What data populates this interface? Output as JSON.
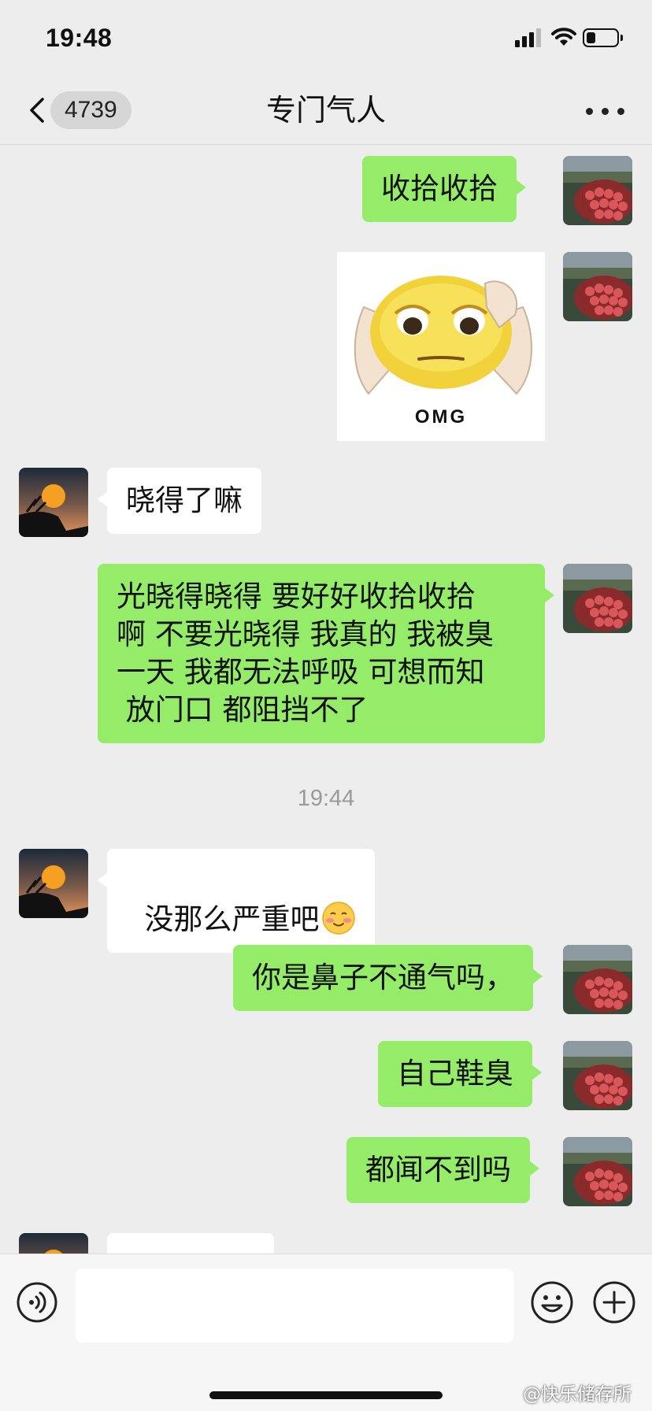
{
  "status_bar": {
    "time": "19:48"
  },
  "nav": {
    "back_count": "4739",
    "title": "专门气人"
  },
  "messages": [
    {
      "text": "收拾收拾"
    },
    {
      "sticker_text": "OMG"
    },
    {
      "text": "晓得了嘛"
    },
    {
      "text": "光晓得晓得 要好好收拾收拾\n啊 不要光晓得 我真的 我被臭\n一天 我都无法呼吸 可想而知\n 放门口 都阻挡不了"
    },
    {
      "text": "没那么严重吧"
    },
    {
      "text": "你是鼻子不通气吗，"
    },
    {
      "text": "自己鞋臭"
    },
    {
      "text": "都闻不到吗"
    }
  ],
  "timestamp": "19:44",
  "input": {
    "placeholder": ""
  },
  "watermark": "@快乐储存所",
  "colors": {
    "me_bubble": "#95ec69",
    "them_bubble": "#ffffff",
    "background": "#ededed"
  },
  "icons": [
    "chevron-left-icon",
    "more-dots-icon",
    "voice-icon",
    "emoji-icon",
    "plus-icon",
    "signal-icon",
    "wifi-icon",
    "battery-icon"
  ]
}
